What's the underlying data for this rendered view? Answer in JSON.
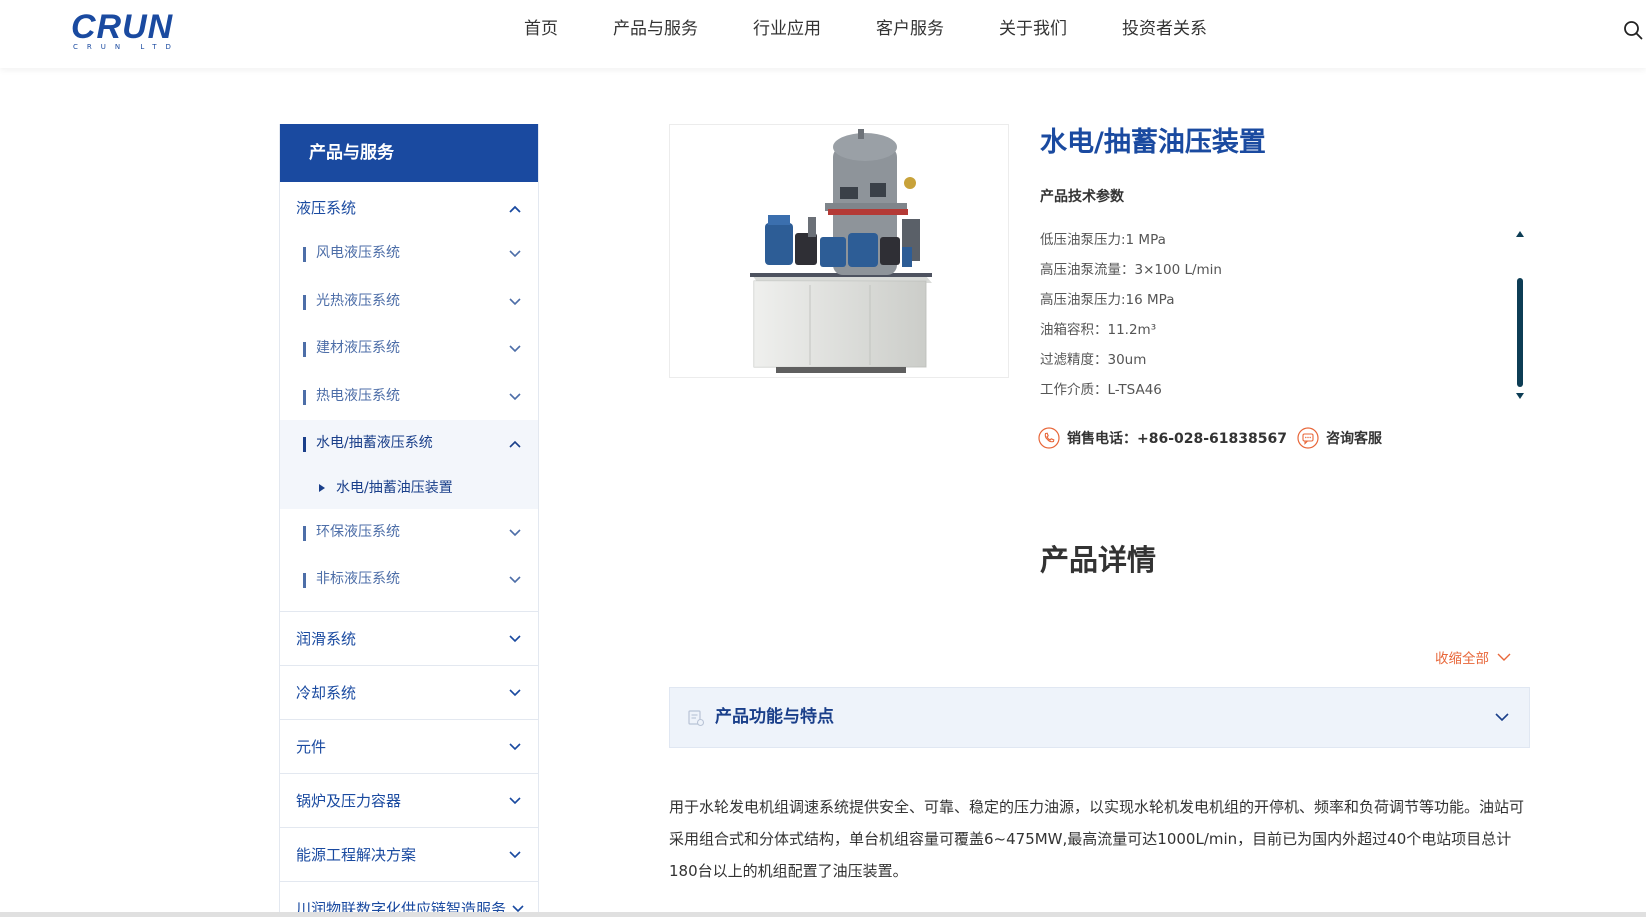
{
  "header": {
    "logo": "CRUN",
    "logo_sub": "CRUN LTD",
    "nav": [
      "首页",
      "产品与服务",
      "行业应用",
      "客户服务",
      "关于我们",
      "投资者关系"
    ]
  },
  "sidebar": {
    "title": "产品与服务",
    "groups": [
      {
        "label": "液压系统",
        "expanded": true,
        "children": [
          {
            "label": "风电液压系统"
          },
          {
            "label": "光热液压系统"
          },
          {
            "label": "建材液压系统"
          },
          {
            "label": "热电液压系统"
          },
          {
            "label": "水电/抽蓄液压系统",
            "expanded": true,
            "children": [
              {
                "label": "水电/抽蓄油压装置"
              }
            ]
          },
          {
            "label": "环保液压系统"
          },
          {
            "label": "非标液压系统"
          }
        ]
      },
      {
        "label": "润滑系统"
      },
      {
        "label": "冷却系统"
      },
      {
        "label": "元件"
      },
      {
        "label": "锅炉及压力容器"
      },
      {
        "label": "能源工程解决方案"
      },
      {
        "label": "川润物联数字化供应链智造服务"
      }
    ]
  },
  "product": {
    "title": "水电/抽蓄油压装置",
    "spec_heading": "产品技术参数",
    "specs": [
      "低压油泵压力:1 MPa",
      "高压油泵流量：3×100 L/min",
      "高压油泵压力:16 MPa",
      "油箱容积：11.2m³",
      "过滤精度：30um",
      "工作介质：L-TSA46"
    ],
    "phone_label": "销售电话：+86-028-61838567",
    "chat_label": "咨询客服"
  },
  "detail": {
    "title": "产品详情",
    "collapse_all": "收缩全部",
    "section_label": "产品功能与特点",
    "description": "用于水轮发电机组调速系统提供安全、可靠、稳定的压力油源，以实现水轮机发电机组的开停机、频率和负荷调节等功能。油站可采用组合式和分体式结构，单台机组容量可覆盖6~475MW,最高流量可达1000L/min，目前已为国内外超过40个电站项目总计180台以上的机组配置了油压装置。"
  },
  "colors": {
    "brand_blue": "#1a4aa0",
    "accent_orange": "#e8673a",
    "scrollbar": "#0d3d55"
  }
}
